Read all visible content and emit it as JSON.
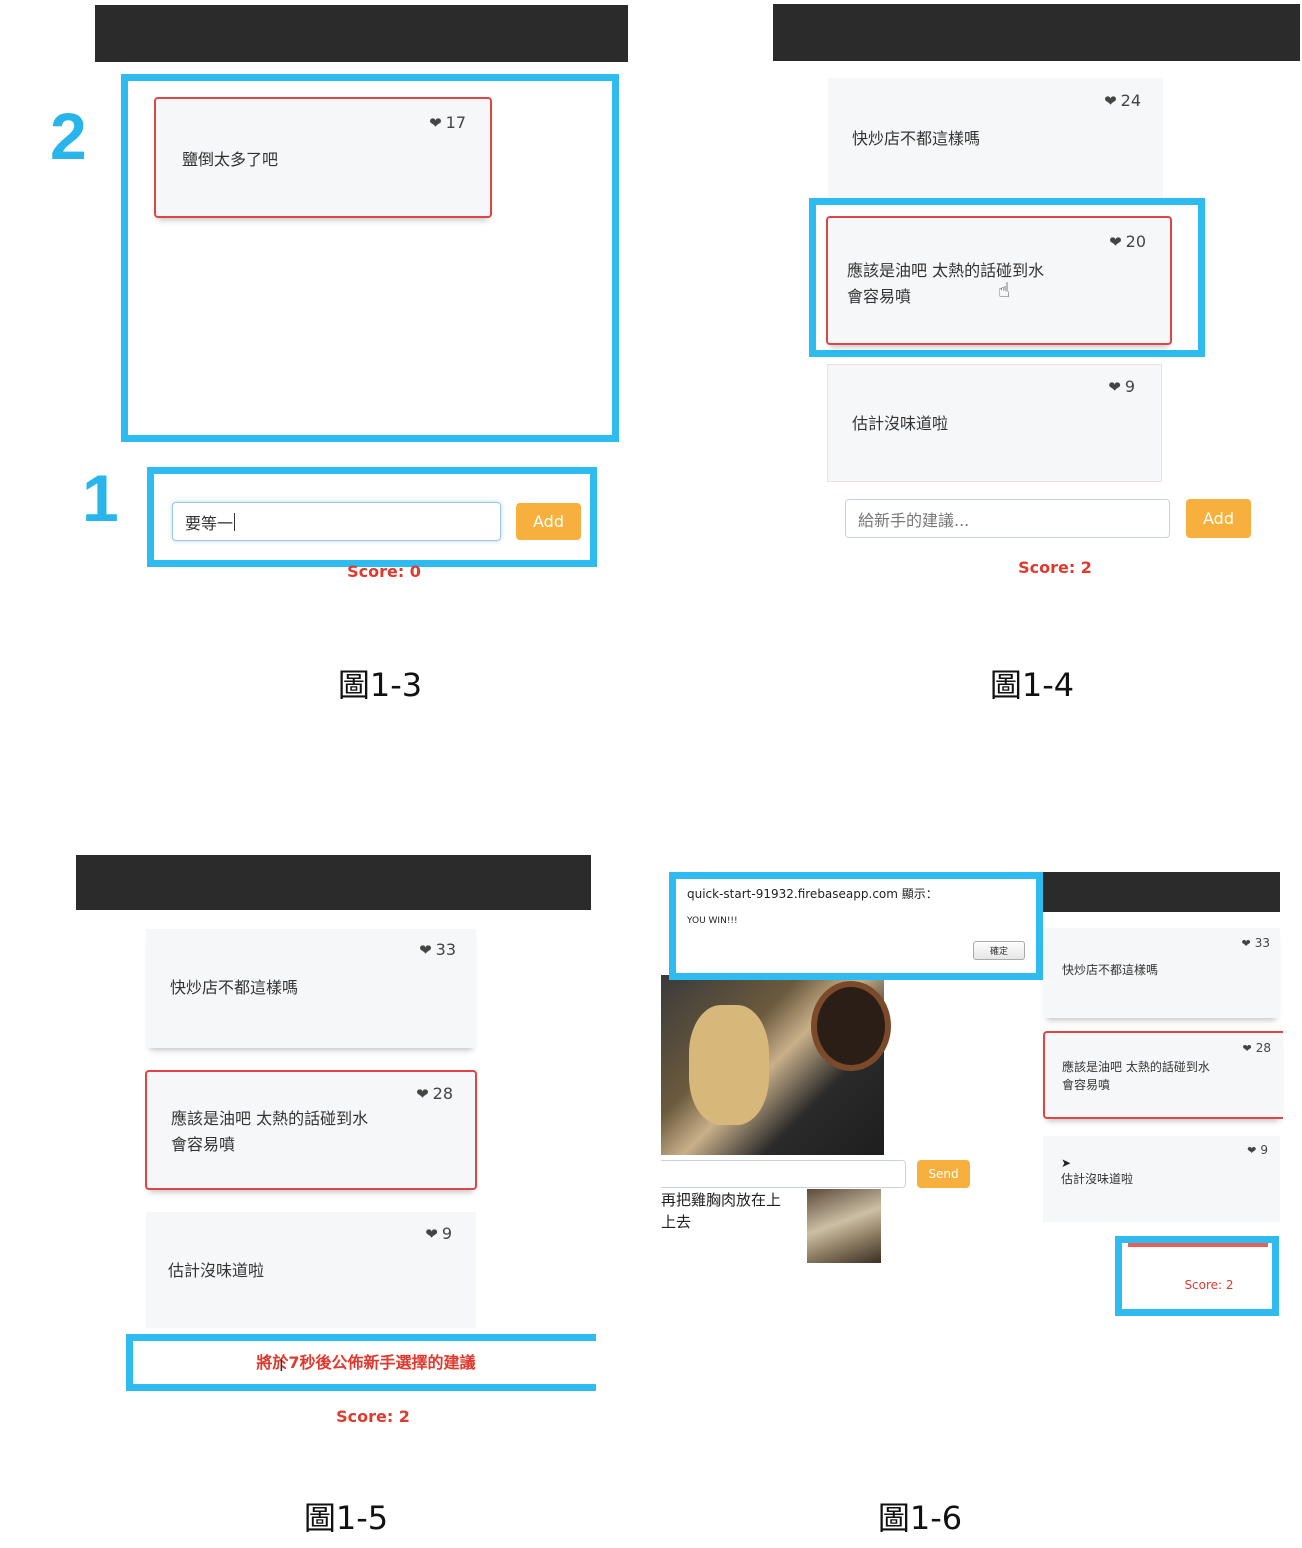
{
  "figures": {
    "fig13": {
      "caption": "圖1-3",
      "marker_2": "2",
      "marker_1": "1",
      "card": {
        "likes": "17",
        "text": "鹽倒太多了吧"
      },
      "input_value": "要等一",
      "add_label": "Add",
      "score": "Score: 0"
    },
    "fig14": {
      "caption": "圖1-4",
      "cards": [
        {
          "likes": "24",
          "text": "快炒店不都這樣嗎"
        },
        {
          "likes": "20",
          "text_line1": "應該是油吧 太熱的話碰到水",
          "text_line2": "會容易噴"
        },
        {
          "likes": "9",
          "text": "估計沒味道啦"
        }
      ],
      "input_placeholder": "給新手的建議...",
      "add_label": "Add",
      "score": "Score: 2"
    },
    "fig15": {
      "caption": "圖1-5",
      "cards": [
        {
          "likes": "33",
          "text": "快炒店不都這樣嗎"
        },
        {
          "likes": "28",
          "text_line1": "應該是油吧 太熱的話碰到水",
          "text_line2": "會容易噴"
        },
        {
          "likes": "9",
          "text": "估計沒味道啦"
        }
      ],
      "announcement": "將於7秒後公佈新手選擇的建議",
      "score": "Score: 2"
    },
    "fig16": {
      "caption": "圖1-6",
      "dialog": {
        "title": "quick-start-91932.firebaseapp.com 顯示：",
        "message": "YOU WIN!!!",
        "ok_label": "確定"
      },
      "send_label": "Send",
      "chat_line1": "再把雞胸肉放在上",
      "chat_line2": "上去",
      "cards": [
        {
          "likes": "33",
          "text": "快炒店不都這樣嗎"
        },
        {
          "likes": "28",
          "text_line1": "應該是油吧 太熱的話碰到水",
          "text_line2": "會容易噴"
        },
        {
          "likes": "9",
          "text": "估計沒味道啦"
        }
      ],
      "score": "Score: 2"
    }
  },
  "colors": {
    "highlight": "#2ebcf0",
    "selected_border": "#e04545",
    "add_button": "#f7b03d",
    "score": "#e03a2f",
    "navbar": "#2b2b2b"
  },
  "icons": [
    "heart-icon",
    "hand-cursor-icon",
    "text-cursor-icon",
    "arrow-cursor-icon"
  ]
}
